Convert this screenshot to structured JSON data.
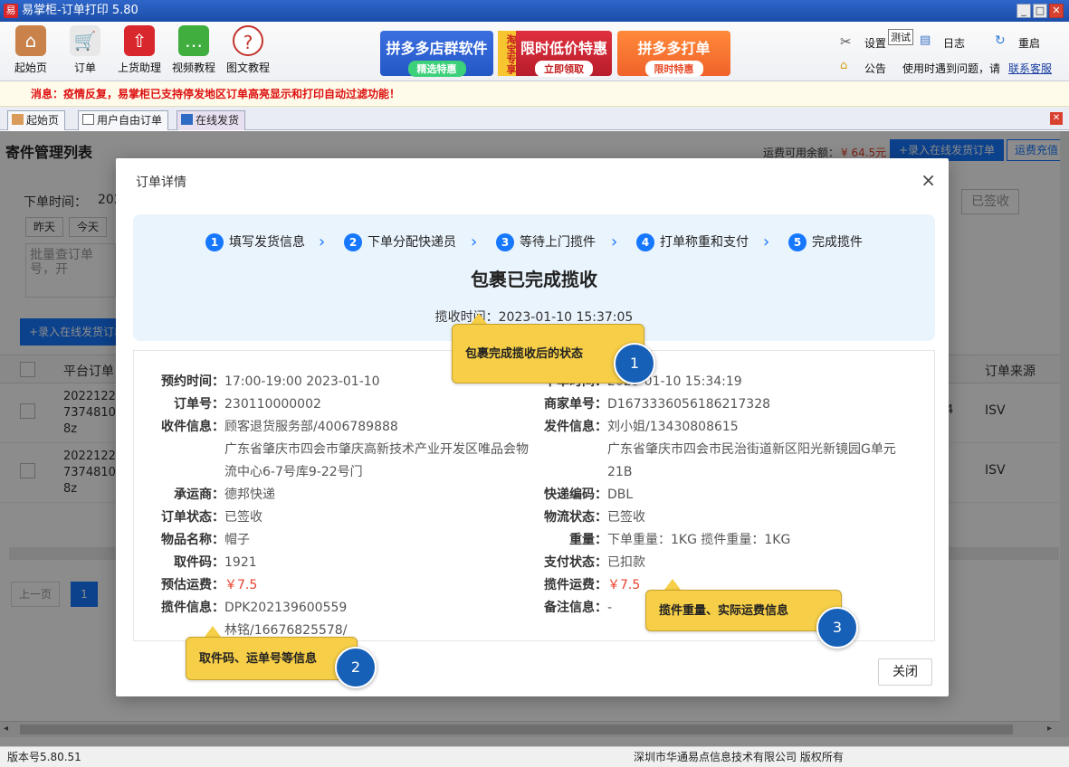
{
  "window": {
    "title": "易掌柜-订单打印 5.80",
    "app_icon": "易"
  },
  "toolbar": {
    "items": [
      {
        "label": "起始页",
        "icon": "home-icon"
      },
      {
        "label": "订单",
        "icon": "cart-icon"
      },
      {
        "label": "上货助理",
        "icon": "upload-bag-icon"
      },
      {
        "label": "视频教程",
        "icon": "chat-bubble-icon"
      },
      {
        "label": "图文教程",
        "icon": "help-icon"
      }
    ],
    "banners": [
      {
        "title": "拼多多店群软件",
        "sub": "精选特惠"
      },
      {
        "side": "淘宝专享",
        "title": "限时低价特惠",
        "sub": "立即领取"
      },
      {
        "title": "拼多多打单",
        "sub": "限时特惠"
      }
    ],
    "right": {
      "settings": "设置",
      "test_badge": "测试",
      "log": "日志",
      "restart": "重启",
      "notice": "公告",
      "help_text": "使用时遇到问题，请",
      "contact": "联系客服"
    }
  },
  "message": {
    "label": "消息：",
    "text": "疫情反复，易掌柜已支持停发地区订单高亮显示和打印自动过滤功能！"
  },
  "tabs": [
    {
      "label": "起始页"
    },
    {
      "label": "用户自由订单"
    },
    {
      "label": "在线发货"
    }
  ],
  "background": {
    "page_title": "寄件管理列表",
    "balance_label": "运费可用余额：",
    "balance_value": "¥ 64.5元",
    "btn_add": "+录入在线发货订单",
    "btn_recharge": "运费充值",
    "order_time_label": "下单时间：",
    "order_time_value": "202",
    "btn_yesterday": "昨天",
    "btn_today": "今天",
    "batch_placeholder": "批量查订单号，开",
    "btn_add2": "+录入在线发货订单",
    "signed_tab": "已签收",
    "col_platform_order": "平台订单",
    "col_source": "订单来源",
    "rows": [
      {
        "order": "2022122 7374810 8z",
        "col3": "4",
        "source": "ISV"
      },
      {
        "order": "2022122 7374810 8z",
        "col3": "i",
        "source": "ISV"
      }
    ],
    "prev_page": "上一页",
    "page_num": "1"
  },
  "modal": {
    "title": "订单详情",
    "close_x": "×",
    "steps": [
      {
        "num": "1",
        "label": "填写发货信息"
      },
      {
        "num": "2",
        "label": "下单分配快递员"
      },
      {
        "num": "3",
        "label": "等待上门揽件"
      },
      {
        "num": "4",
        "label": "打单称重和支付"
      },
      {
        "num": "5",
        "label": "完成揽件"
      }
    ],
    "status": "包裹已完成揽收",
    "pickup_time_label": "揽收时间：",
    "pickup_time": "2023-01-10 15:37:05",
    "left": [
      {
        "k": "预约时间：",
        "v": "17:00-19:00 2023-01-10"
      },
      {
        "k": "订单号：",
        "v": "230110000002"
      },
      {
        "k": "收件信息：",
        "v": "顾客退货服务部/4006789888"
      },
      {
        "k": "",
        "v": "广东省肇庆市四会市肇庆高新技术产业开发区唯品会物"
      },
      {
        "k": "",
        "v": "流中心6-7号库9-22号门"
      },
      {
        "k": "承运商：",
        "v": "德邦快递"
      },
      {
        "k": "订单状态：",
        "v": "已签收"
      },
      {
        "k": "物品名称：",
        "v": "帽子"
      },
      {
        "k": "取件码：",
        "v": "1921"
      },
      {
        "k": "预估运费：",
        "v": "￥7.5"
      },
      {
        "k": "揽件信息：",
        "v": "DPK202139600559"
      },
      {
        "k": "",
        "v": "林铭/16676825578/"
      }
    ],
    "right": [
      {
        "k": "下单时间：",
        "v": "2023-01-10 15:34:19"
      },
      {
        "k": "商家单号：",
        "v": "D1673336056186217328"
      },
      {
        "k": "发件信息：",
        "v": "刘小姐/13430808615"
      },
      {
        "k": "",
        "v": "广东省肇庆市四会市民治街道新区阳光新镜园G单元"
      },
      {
        "k": "",
        "v": "21B"
      },
      {
        "k": "快递编码：",
        "v": "DBL"
      },
      {
        "k": "物流状态：",
        "v": "已签收"
      },
      {
        "k": "重量：",
        "v": "下单重量：1KG  揽件重量：1KG"
      },
      {
        "k": "支付状态：",
        "v": "已扣款"
      },
      {
        "k": "揽件运费：",
        "v": "￥7.5"
      },
      {
        "k": "备注信息：",
        "v": "-"
      }
    ],
    "close_button": "关闭"
  },
  "callouts": [
    {
      "num": "1",
      "text": "包裹完成揽收后的状态"
    },
    {
      "num": "2",
      "text": "取件码、运单号等信息"
    },
    {
      "num": "3",
      "text": "揽件重量、实际运费信息"
    }
  ],
  "status_bar": {
    "version": "版本号5.80.51",
    "copyright": "深圳市华通易点信息技术有限公司 版权所有"
  },
  "colors": {
    "accent": "#1677ff",
    "price": "#e8412c",
    "callout": "#f6ce47",
    "callout_num": "#1660b8"
  }
}
